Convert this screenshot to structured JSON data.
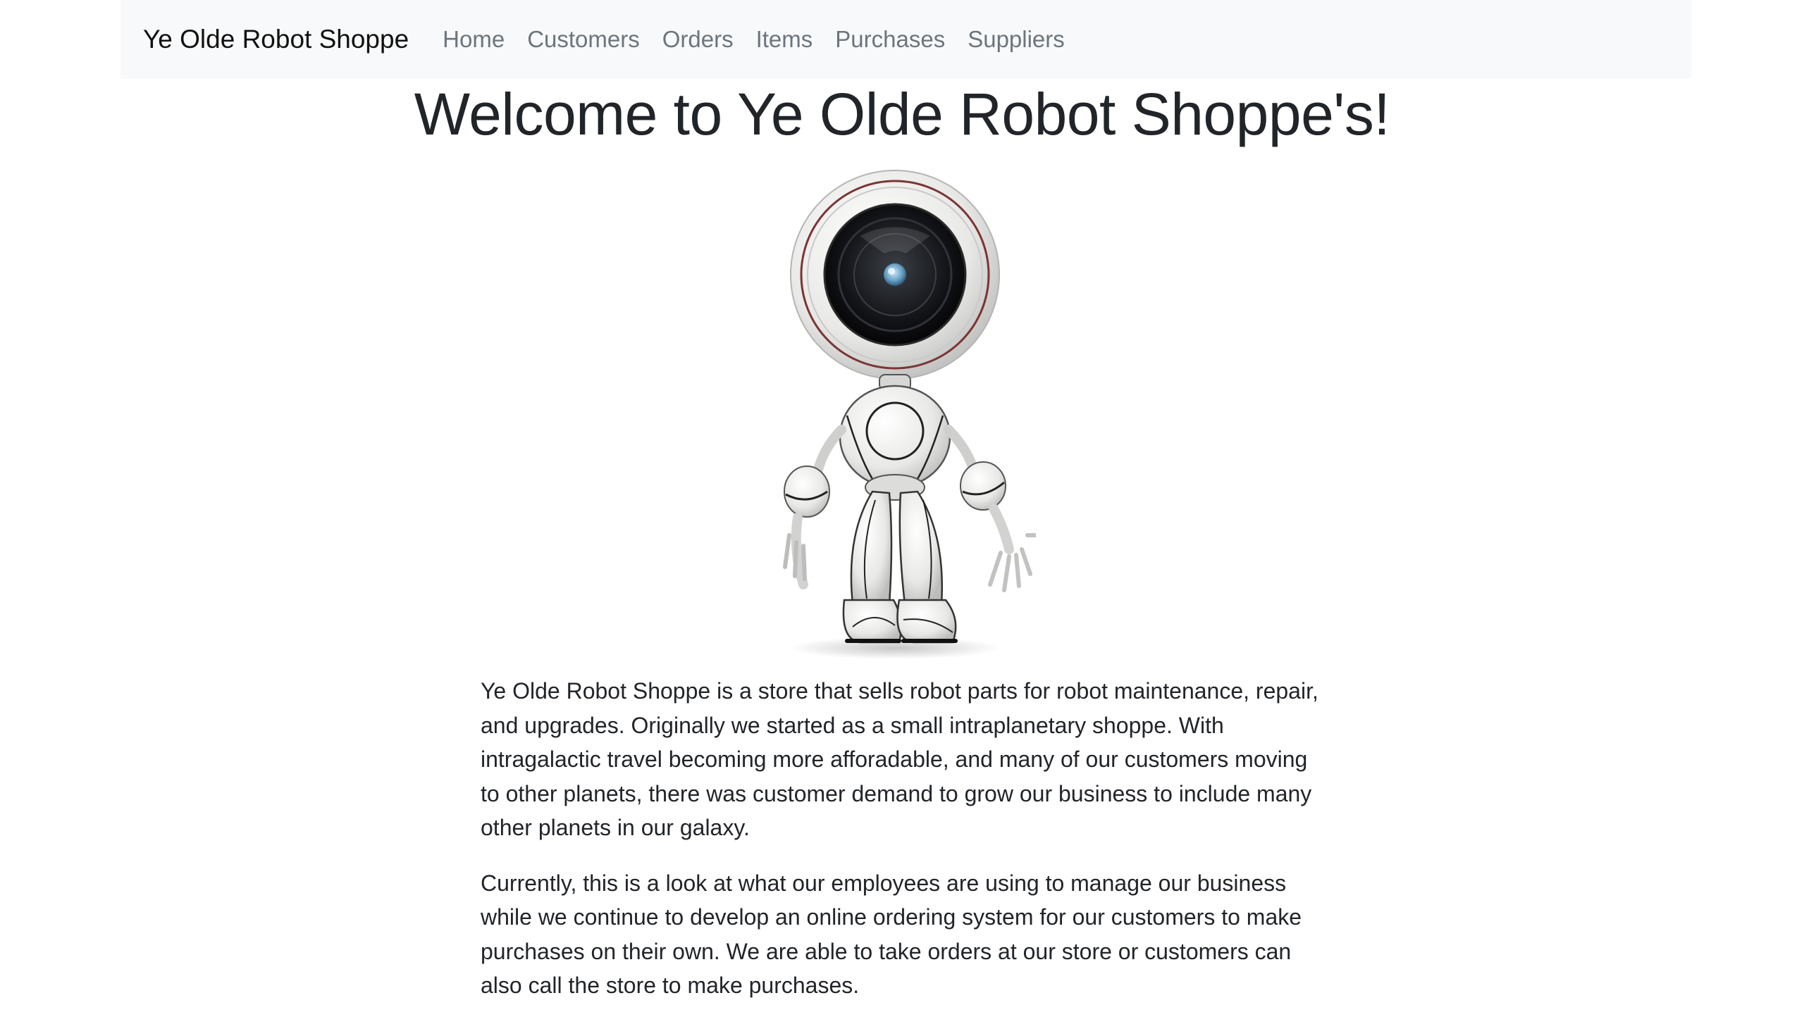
{
  "navbar": {
    "brand": "Ye Olde Robot Shoppe",
    "links": [
      "Home",
      "Customers",
      "Orders",
      "Items",
      "Purchases",
      "Suppliers"
    ]
  },
  "main": {
    "title": "Welcome to Ye Olde Robot Shoppe's!",
    "image": "robot-mascot",
    "paragraphs": [
      "Ye Olde Robot Shoppe is a store that sells robot parts for robot maintenance, repair, and upgrades. Originally we started as a small intraplanetary shoppe. With intragalactic travel becoming more afforadable, and many of our customers moving to other planets, there was customer demand to grow our business to include many other planets in our galaxy.",
      "Currently, this is a look at what our employees are using to manage our business while we continue to develop an online ordering system for our customers to make purchases on their own. We are able to take orders at our store or customers can also call the store to make purchases."
    ]
  },
  "colors": {
    "navbar_bg": "#f8f9fa",
    "nav_link": "#6c757d",
    "text": "#212529"
  }
}
